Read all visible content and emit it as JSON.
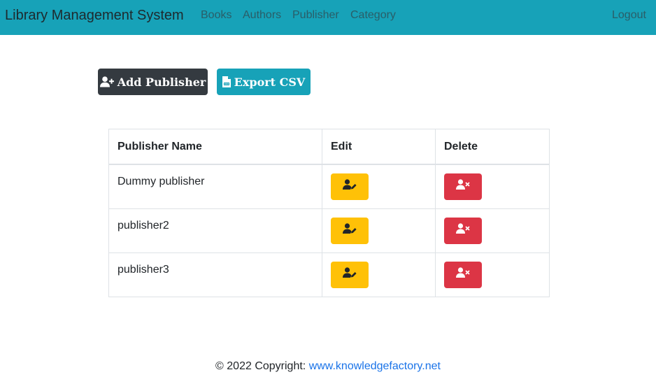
{
  "navbar": {
    "brand": "Library Management System",
    "links": [
      "Books",
      "Authors",
      "Publisher",
      "Category"
    ],
    "logout": "Logout",
    "bg_color": "#17a2b8"
  },
  "actions": {
    "add_label": "Add Publisher",
    "export_label": "Export CSV",
    "add_icon": "user-plus-icon",
    "export_icon": "file-csv-icon"
  },
  "table": {
    "headers": [
      "Publisher Name",
      "Edit",
      "Delete"
    ],
    "rows": [
      {
        "name": "Dummy publisher"
      },
      {
        "name": "publisher2"
      },
      {
        "name": "publisher3"
      }
    ],
    "edit_icon": "user-edit-icon",
    "delete_icon": "user-times-icon",
    "edit_color": "#ffc107",
    "delete_color": "#dc3545"
  },
  "footer": {
    "text": "© 2022 Copyright: ",
    "link": "www.knowledgefactory.net"
  }
}
